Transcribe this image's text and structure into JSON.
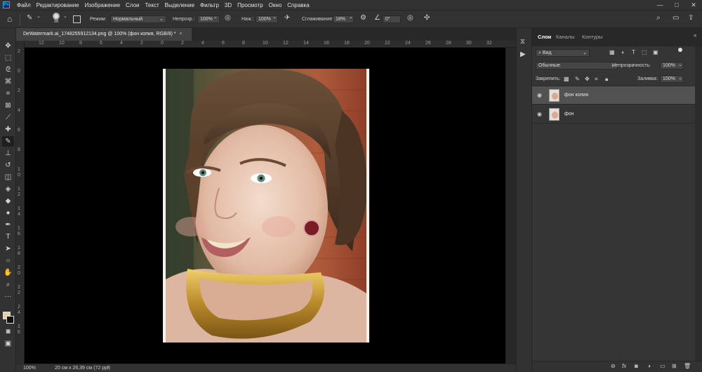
{
  "app": {
    "logo": "Ps"
  },
  "menu": [
    "Файл",
    "Редактирование",
    "Изображение",
    "Слои",
    "Текст",
    "Выделение",
    "Фильтр",
    "3D",
    "Просмотр",
    "Окно",
    "Справка"
  ],
  "window_controls": {
    "minimize": "—",
    "restore": "□",
    "close": "✕"
  },
  "options": {
    "brush_size": "36",
    "mode_label": "Режим:",
    "mode_value": "Нормальный",
    "opacity_label": "Непрозр.:",
    "opacity_value": "100%",
    "flow_label": "Наж.:",
    "flow_value": "100%",
    "smoothing_label": "Сглаживание:",
    "smoothing_value": "18%",
    "angle_value": "0°"
  },
  "document": {
    "tab_title": "DeWatermark.ai_1748255912134.png @ 100% (фон копия, RGB/8) *",
    "close": "×"
  },
  "ruler_h": [
    "12",
    "10",
    "8",
    "6",
    "4",
    "2",
    "0",
    "2",
    "4",
    "6",
    "8",
    "10",
    "12",
    "14",
    "16",
    "18",
    "20",
    "22",
    "24",
    "26",
    "28",
    "30",
    "32"
  ],
  "ruler_v": [
    "2",
    "0",
    "2",
    "4",
    "6",
    "8",
    "1 0",
    "1 2",
    "1 4",
    "1 6",
    "1 8",
    "2 0",
    "2 2",
    "2 4",
    "2 6"
  ],
  "status": {
    "zoom": "100%",
    "doc_size": "20 см x 26,39 см (72 ppi)"
  },
  "panel": {
    "tabs": [
      "Слои",
      "Каналы",
      "Контуры"
    ],
    "filter_kind": "Вид",
    "blend_mode": "Обычные",
    "opacity_label": "Непрозрачность:",
    "opacity_value": "100%",
    "lock_label": "Закрепить:",
    "fill_label": "Заливка:",
    "fill_value": "100%",
    "layers": [
      {
        "name": "фон копия",
        "selected": true
      },
      {
        "name": "фон",
        "selected": false
      }
    ],
    "bottom_icons": [
      "link-icon",
      "fx-icon",
      "mask-icon",
      "adjustment-icon",
      "group-icon",
      "new-layer-icon",
      "trash-icon"
    ],
    "fx_label": "fx"
  },
  "colors": {
    "chrome_dark": "#323232",
    "canvas_bg": "#000000",
    "panel_bg": "#353535",
    "selected_layer": "#525252",
    "foreground_swatch": "#e9d0a3",
    "background_swatch": "#111111"
  }
}
